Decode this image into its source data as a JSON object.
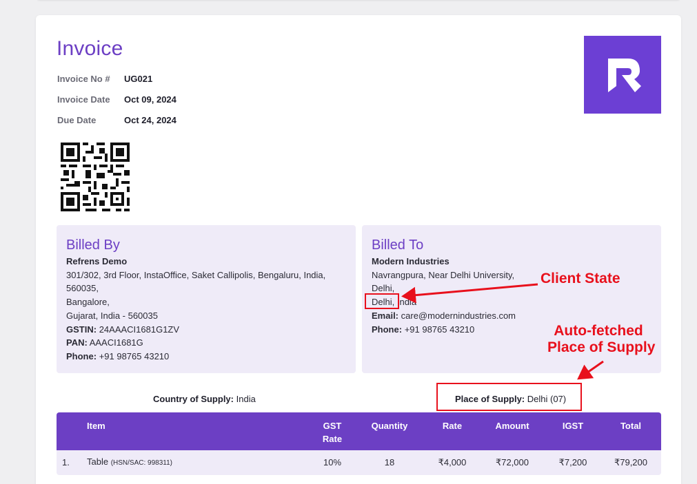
{
  "invoice": {
    "title": "Invoice",
    "number_label": "Invoice No #",
    "number": "UG021",
    "date_label": "Invoice Date",
    "date": "Oct 09, 2024",
    "due_label": "Due Date",
    "due": "Oct 24, 2024"
  },
  "logo": {
    "icon": "refrens-logo-icon",
    "color": "#6c3fd4"
  },
  "billed_by": {
    "heading": "Billed By",
    "name": "Refrens Demo",
    "address1": "301/302, 3rd Floor, InstaOffice, Saket Callipolis, Bengaluru, India,",
    "address2": "560035,",
    "city": "Bangalore,",
    "state_line": "Gujarat, India - 560035",
    "gstin_label": "GSTIN:",
    "gstin": "24AAACI1681G1ZV",
    "pan_label": "PAN:",
    "pan": "AAACI1681G",
    "phone_label": "Phone:",
    "phone": "+91 98765 43210"
  },
  "billed_to": {
    "heading": "Billed To",
    "name": "Modern Industries",
    "address1": "Navrangpura, Near Delhi University,",
    "address2": "Delhi,",
    "state": "Delhi,",
    "country": " India",
    "email_label": "Email:",
    "email": "care@modernindustries.com",
    "phone_label": "Phone:",
    "phone": "+91 98765 43210"
  },
  "supply": {
    "country_label": "Country of Supply:",
    "country": "India",
    "place_label": "Place of Supply:",
    "place": "Delhi (07)"
  },
  "table": {
    "headers": {
      "item": "Item",
      "gst_line1": "GST",
      "gst_line2": "Rate",
      "quantity": "Quantity",
      "rate": "Rate",
      "amount": "Amount",
      "igst": "IGST",
      "total": "Total"
    },
    "rows": [
      {
        "index": "1.",
        "item": "Table",
        "hsn": "(HSN/SAC: 998311)",
        "gst": "10%",
        "quantity": "18",
        "rate": "₹4,000",
        "amount": "₹72,000",
        "igst": "₹7,200",
        "total": "₹79,200"
      }
    ]
  },
  "annotations": {
    "client_state": "Client State",
    "place_line1": "Auto-fetched",
    "place_line2": "Place of Supply",
    "color": "#e8101c"
  },
  "colors": {
    "accent": "#6c3fc4",
    "panel": "#efebf8"
  }
}
